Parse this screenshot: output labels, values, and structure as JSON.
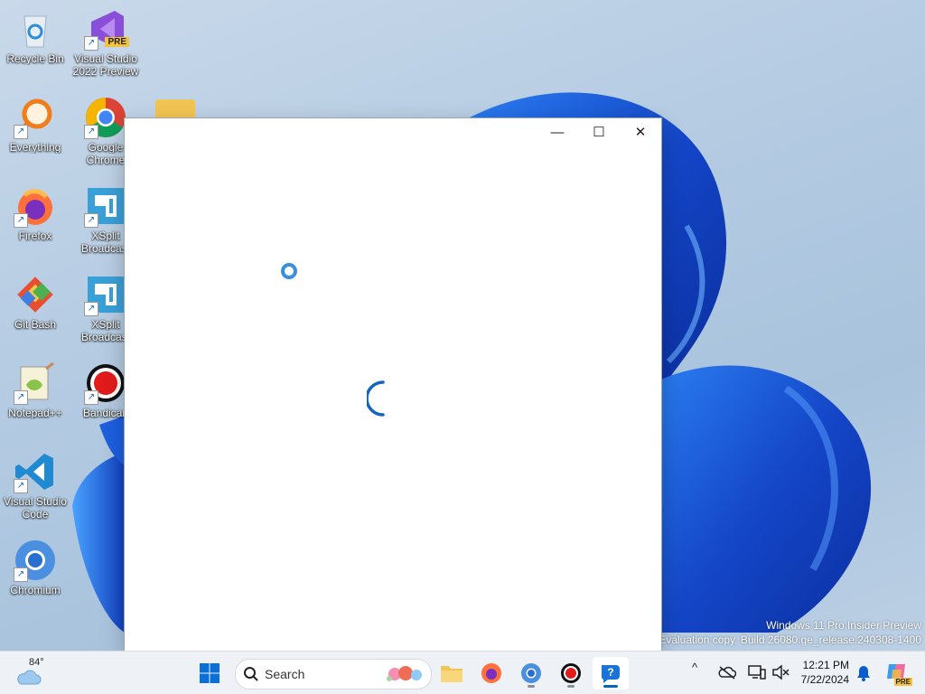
{
  "desktop": {
    "icons": [
      {
        "label": "Recycle Bin",
        "icon": "recycle-bin-icon"
      },
      {
        "label": "Visual Studio 2022 Preview",
        "line1": "Visual Studio",
        "line2": "2022 Preview",
        "badge": "PRE",
        "icon": "visual-studio-icon"
      },
      {
        "label": "Everything",
        "icon": "everything-icon"
      },
      {
        "label": "Google Chrome",
        "line1": "Google",
        "line2": "Chrome",
        "icon": "chrome-icon"
      },
      {
        "label": "Firefox",
        "icon": "firefox-icon"
      },
      {
        "label": "XSplit Broadcaster",
        "line1": "XSplit",
        "line2": "Broadcast",
        "icon": "xsplit-icon"
      },
      {
        "label": "Git Bash",
        "icon": "git-bash-icon"
      },
      {
        "label": "XSplit Broadcaster",
        "line1": "XSplit",
        "line2": "Broadcast",
        "icon": "xsplit-icon"
      },
      {
        "label": "Notepad++",
        "icon": "notepadpp-icon"
      },
      {
        "label": "Bandicam",
        "line1": "Bandican",
        "icon": "bandicam-icon"
      },
      {
        "label": "Visual Studio Code",
        "line1": "Visual Studio",
        "line2": "Code",
        "icon": "vscode-icon"
      },
      {
        "label": "Chromium",
        "icon": "chromium-icon"
      }
    ],
    "watermark_line1": "Windows 11 Pro Insider Preview",
    "watermark_line2": "Evaluation copy. Build 26080.ge_release.240308-1400"
  },
  "window": {
    "minimize": "—",
    "maximize": "☐",
    "close": "✕"
  },
  "taskbar": {
    "weather_temp": "84°",
    "search_placeholder": "Search",
    "time": "12:21 PM",
    "date": "7/22/2024",
    "copilot_badge": "PRE"
  },
  "colors": {
    "accent": "#0067c0",
    "bloom": "#1a5be0"
  }
}
